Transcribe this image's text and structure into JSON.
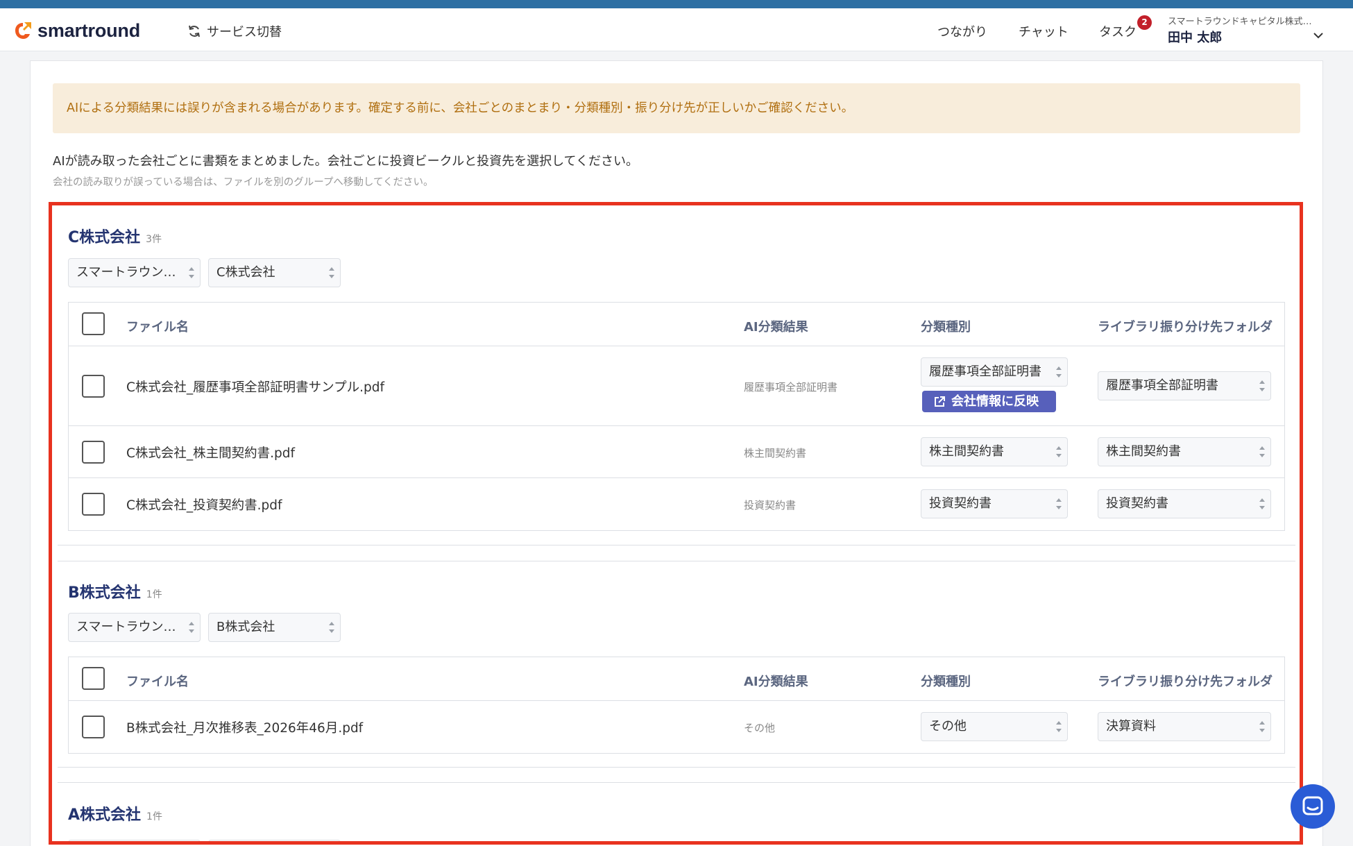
{
  "header": {
    "logo_text": "smartround",
    "service_switch_label": "サービス切替",
    "nav_connections": "つながり",
    "nav_chat": "チャット",
    "nav_tasks": "タスク",
    "tasks_badge": "2",
    "org_name": "スマートラウンドキャピタル株式…",
    "user_name": "田中 太郎"
  },
  "notice": {
    "warning": "AIによる分類結果には誤りが含まれる場合があります。確定する前に、会社ごとのまとまり・分類種別・振り分け先が正しいかご確認ください。",
    "intro": "AIが読み取った会社ごとに書類をまとめました。会社ごとに投資ビークルと投資先を選択してください。",
    "hint": "会社の読み取りが誤っている場合は、ファイルを別のグループへ移動してください。"
  },
  "table_headers": {
    "file_name": "ファイル名",
    "ai_result": "AI分類結果",
    "category": "分類種別",
    "folder": "ライブラリ振り分け先フォルダ"
  },
  "reflect_label": "会社情報に反映",
  "groups": [
    {
      "name": "C株式会社",
      "count": "3件",
      "vehicle": "スマートラウン…",
      "company": "C株式会社",
      "files": [
        {
          "file": "C株式会社_履歴事項全部証明書サンプル.pdf",
          "ai": "履歴事項全部証明書",
          "category": "履歴事項全部証明書",
          "folder": "履歴事項全部証明書"
        },
        {
          "file": "C株式会社_株主間契約書.pdf",
          "ai": "株主間契約書",
          "category": "株主間契約書",
          "folder": "株主間契約書"
        },
        {
          "file": "C株式会社_投資契約書.pdf",
          "ai": "投資契約書",
          "category": "投資契約書",
          "folder": "投資契約書"
        }
      ]
    },
    {
      "name": "B株式会社",
      "count": "1件",
      "vehicle": "スマートラウン…",
      "company": "B株式会社",
      "files": [
        {
          "file": "B株式会社_月次推移表_2026年46月.pdf",
          "ai": "その他",
          "category": "その他",
          "folder": "決算資料"
        }
      ]
    },
    {
      "name": "A株式会社",
      "count": "1件",
      "vehicle": "",
      "company": "",
      "files": []
    }
  ],
  "colors": {
    "top_stripe": "#2d6fa3",
    "warning_bg": "#f8eddb",
    "warning_text": "#b06f10",
    "highlight_border": "#e8321f",
    "reflect_button": "#5760bb",
    "badge": "#c2202a",
    "chat_button": "#2a5cd6"
  }
}
